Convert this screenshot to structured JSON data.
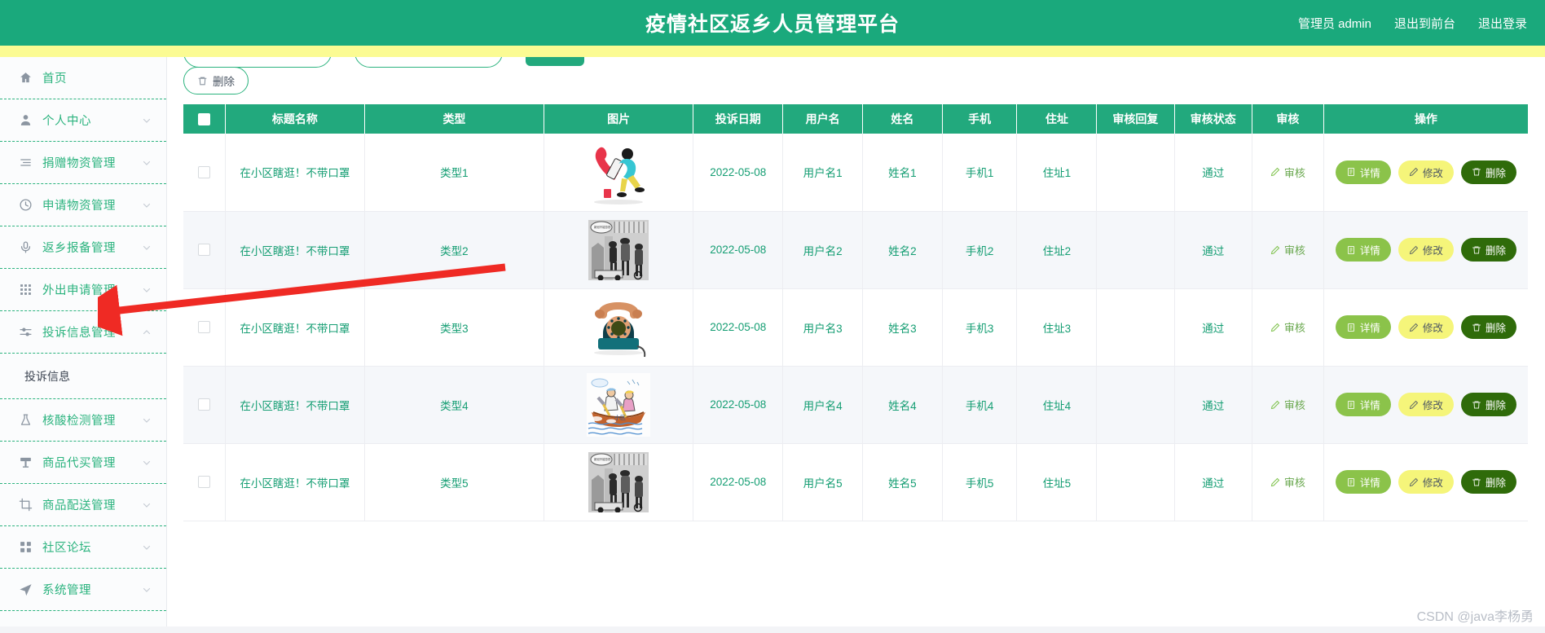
{
  "header": {
    "title": "疫情社区返乡人员管理平台",
    "links": [
      {
        "label": "管理员 admin",
        "name": "admin-user-link"
      },
      {
        "label": "退出到前台",
        "name": "exit-to-frontend-link"
      },
      {
        "label": "退出登录",
        "name": "logout-link"
      }
    ],
    "bg_color": "#1aa97c",
    "accent_bar_color": "#fbfb93"
  },
  "sidebar": {
    "items": [
      {
        "label": "首页",
        "icon": "home-icon",
        "expandable": false
      },
      {
        "label": "个人中心",
        "icon": "user-icon",
        "expandable": true,
        "expanded": false
      },
      {
        "label": "捐赠物资管理",
        "icon": "list-icon",
        "expandable": true,
        "expanded": false
      },
      {
        "label": "申请物资管理",
        "icon": "clock-icon",
        "expandable": true,
        "expanded": false
      },
      {
        "label": "返乡报备管理",
        "icon": "microphone-icon",
        "expandable": true,
        "expanded": false
      },
      {
        "label": "外出申请管理",
        "icon": "grid-icon",
        "expandable": true,
        "expanded": false
      },
      {
        "label": "投诉信息管理",
        "icon": "sliders-icon",
        "expandable": true,
        "expanded": true
      },
      {
        "label": "核酸检测管理",
        "icon": "flask-icon",
        "expandable": true,
        "expanded": false
      },
      {
        "label": "商品代买管理",
        "icon": "cart-icon",
        "expandable": true,
        "expanded": false
      },
      {
        "label": "商品配送管理",
        "icon": "crop-icon",
        "expandable": true,
        "expanded": false
      },
      {
        "label": "社区论坛",
        "icon": "blocks-icon",
        "expandable": true,
        "expanded": false
      },
      {
        "label": "系统管理",
        "icon": "send-icon",
        "expandable": true,
        "expanded": false
      }
    ],
    "submenu": {
      "parent": "投诉信息管理",
      "label": "投诉信息"
    }
  },
  "toolbar": {
    "batch_delete_label": "删除",
    "batch_delete_icon": "trash-icon"
  },
  "table": {
    "columns": [
      {
        "label": "",
        "name": "select-all-column"
      },
      {
        "label": "标题名称",
        "name": "title-column"
      },
      {
        "label": "类型",
        "name": "type-column"
      },
      {
        "label": "图片",
        "name": "image-column"
      },
      {
        "label": "投诉日期",
        "name": "date-column"
      },
      {
        "label": "用户名",
        "name": "username-column"
      },
      {
        "label": "姓名",
        "name": "name-column"
      },
      {
        "label": "手机",
        "name": "phone-column"
      },
      {
        "label": "住址",
        "name": "address-column"
      },
      {
        "label": "审核回复",
        "name": "audit-reply-column"
      },
      {
        "label": "审核状态",
        "name": "audit-status-column"
      },
      {
        "label": "审核",
        "name": "audit-column"
      },
      {
        "label": "操作",
        "name": "actions-column"
      }
    ],
    "rows": [
      {
        "title": "在小区瞎逛！不带口罩",
        "type": "类型1",
        "image": "telephone-running-person",
        "date": "2022-05-08",
        "username": "用户名1",
        "name": "姓名1",
        "phone": "手机1",
        "address": "住址1",
        "audit_reply": "",
        "audit_status": "通过",
        "audit_label": "审核"
      },
      {
        "title": "在小区瞎逛！不带口罩",
        "type": "类型2",
        "image": "street-scene-bw",
        "date": "2022-05-08",
        "username": "用户名2",
        "name": "姓名2",
        "phone": "手机2",
        "address": "住址2",
        "audit_reply": "",
        "audit_status": "通过",
        "audit_label": "审核"
      },
      {
        "title": "在小区瞎逛！不带口罩",
        "type": "类型3",
        "image": "vintage-telephone",
        "date": "2022-05-08",
        "username": "用户名3",
        "name": "姓名3",
        "phone": "手机3",
        "address": "住址3",
        "audit_reply": "",
        "audit_status": "通过",
        "audit_label": "审核"
      },
      {
        "title": "在小区瞎逛！不带口罩",
        "type": "类型4",
        "image": "rowing-boat",
        "date": "2022-05-08",
        "username": "用户名4",
        "name": "姓名4",
        "phone": "手机4",
        "address": "住址4",
        "audit_reply": "",
        "audit_status": "通过",
        "audit_label": "审核"
      },
      {
        "title": "在小区瞎逛！不带口罩",
        "type": "类型5",
        "image": "street-scene-bw",
        "date": "2022-05-08",
        "username": "用户名5",
        "name": "姓名5",
        "phone": "手机5",
        "address": "住址5",
        "audit_reply": "",
        "audit_status": "通过",
        "audit_label": "审核"
      }
    ],
    "row_actions": [
      {
        "label": "详情",
        "icon": "document-icon",
        "style": "op-detail"
      },
      {
        "label": "修改",
        "icon": "pencil-icon",
        "style": "op-edit"
      },
      {
        "label": "删除",
        "icon": "trash-icon",
        "style": "op-del"
      }
    ]
  },
  "watermark": "CSDN @java李杨勇",
  "colors": {
    "primary_green": "#22a97d",
    "link_green": "#159e73",
    "yellow_bar": "#fbfb93",
    "detail_button": "#8bc34a",
    "edit_button": "#f5f57a",
    "delete_button": "#2f6b0a",
    "annotation_arrow": "#ef2a24"
  }
}
